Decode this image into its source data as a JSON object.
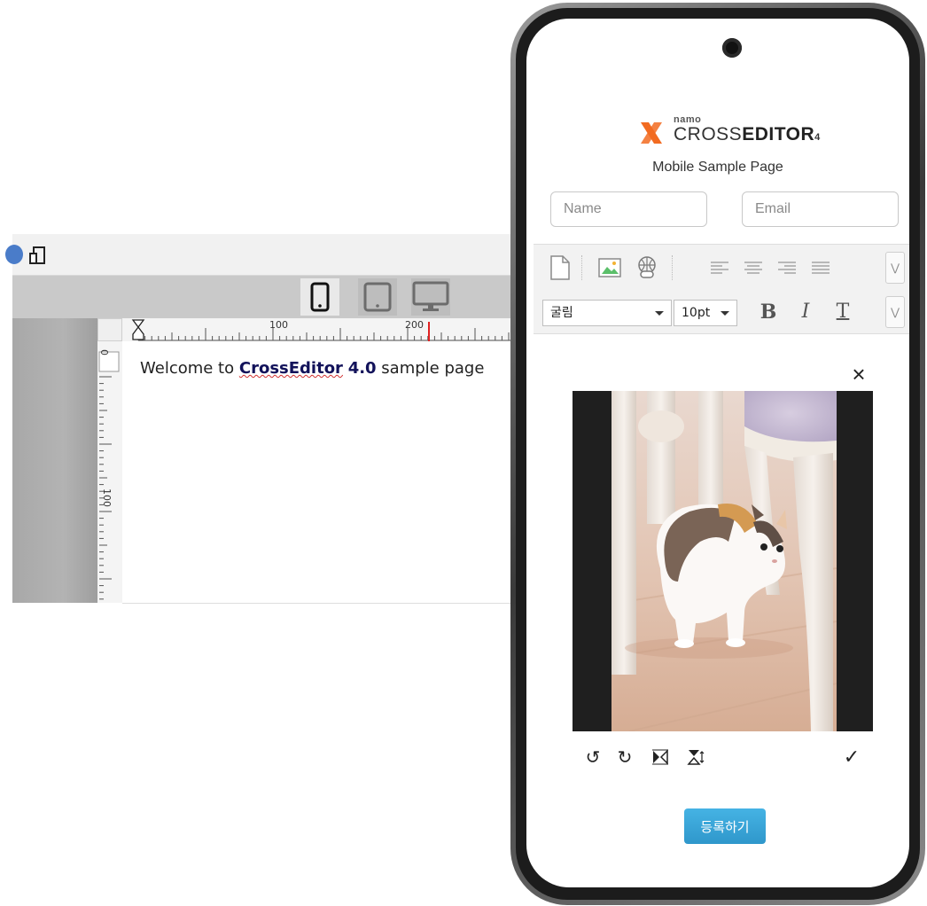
{
  "desktop_editor": {
    "topbar_icons": [
      "globe-icon",
      "mobile-device-icon"
    ],
    "device_buttons": [
      {
        "name": "phone-view",
        "icon": "smartphone-icon",
        "active": true
      },
      {
        "name": "tablet-view",
        "icon": "tablet-icon",
        "active": false
      },
      {
        "name": "desktop-view",
        "icon": "monitor-icon",
        "active": false
      }
    ],
    "hruler_labels": [
      "100",
      "200"
    ],
    "vruler_labels": [
      "0",
      "100"
    ],
    "content": {
      "prefix": "Welcome to ",
      "brand": "CrossEditor",
      "version": "4.0",
      "suffix": " sample page"
    }
  },
  "mobile": {
    "logo": {
      "namo": "namo",
      "cross": "CROSS",
      "editor": "EDITOR",
      "version": "4"
    },
    "subtitle": "Mobile Sample Page",
    "name_placeholder": "Name",
    "email_placeholder": "Email",
    "toolbar_row1_icons": [
      "new-document-icon",
      "insert-image-icon",
      "insert-link-icon",
      "align-left-icon",
      "align-center-icon",
      "align-right-icon",
      "align-justify-icon"
    ],
    "font_family": "굴림",
    "font_size": "10pt",
    "format_bold": "B",
    "format_italic": "I",
    "format_text": "T",
    "image_tools": [
      "rotate-left-icon",
      "rotate-right-icon",
      "flip-horizontal-icon",
      "flip-vertical-icon"
    ],
    "submit_label": "등록하기"
  },
  "colors": {
    "accent": "#2f97cb",
    "logo_orange": "#f26b21",
    "toolbar_bg": "#f2f2f2"
  }
}
